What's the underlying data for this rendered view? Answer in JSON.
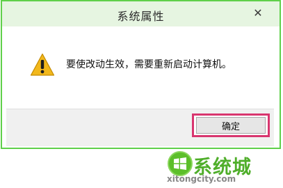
{
  "dialog": {
    "title": "系统属性",
    "close_glyph": "✕",
    "message": "要使改动生效，需要重新启动计算机。",
    "icon": "warning-icon",
    "ok_label": "确定"
  },
  "watermark": {
    "text": "系统城",
    "url": "xitongcity.com",
    "icon": "windows-logo-icon"
  },
  "colors": {
    "dialog_border": "#5fd04a",
    "titlebar": "#e6f5e1",
    "highlight": "#d8356f",
    "warning": "#f2b81c",
    "watermark_green": "#4fae2a"
  }
}
